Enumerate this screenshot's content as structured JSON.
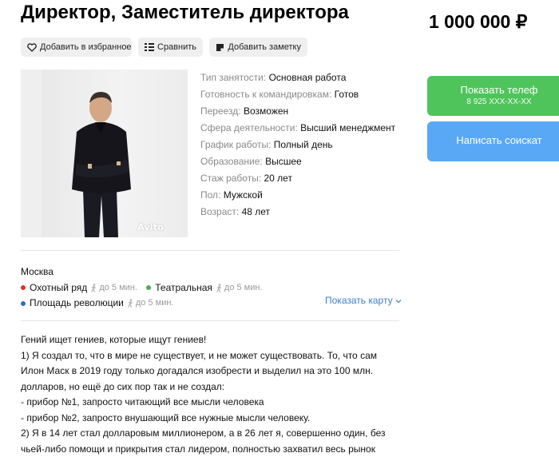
{
  "header": {
    "title": "Директор, Заместитель директора",
    "price": "1 000 000 ₽"
  },
  "actions": {
    "favorite": "Добавить в избранное",
    "compare": "Сравнить",
    "note": "Добавить заметку"
  },
  "photo": {
    "watermark": "Avito"
  },
  "params": [
    {
      "label": "Тип занятости:",
      "value": "Основная работа"
    },
    {
      "label": "Готовность к командировкам:",
      "value": "Готов"
    },
    {
      "label": "Переезд:",
      "value": "Возможен"
    },
    {
      "label": "Сфера деятельности:",
      "value": "Высший менеджмент"
    },
    {
      "label": "График работы:",
      "value": "Полный день"
    },
    {
      "label": "Образование:",
      "value": "Высшее"
    },
    {
      "label": "Стаж работы:",
      "value": "20 лет"
    },
    {
      "label": "Пол:",
      "value": "Мужской"
    },
    {
      "label": "Возраст:",
      "value": "48 лет"
    }
  ],
  "contact": {
    "phone_label": "Показать телеф",
    "phone_number": "8 925 XXX-XX-XX",
    "write_label": "Написать соискат"
  },
  "location": {
    "city": "Москва",
    "metro": [
      {
        "name": "Охотный ряд",
        "walk": "до 5 мин.",
        "color": "#e0322c"
      },
      {
        "name": "Театральная",
        "walk": "до 5 мин.",
        "color": "#4caf50"
      },
      {
        "name": "Площадь революции",
        "walk": "до 5 мин.",
        "color": "#2f6fc4"
      }
    ],
    "map_link": "Показать карту"
  },
  "description": [
    "Гений ищет гениев, которые ищут гениев!",
    "1) Я создал то, что в мире не существует, и не может существовать. То, что сам",
    "Илон Маск в 2019 году только догадался изобрести и выделил на это 100 млн.",
    "долларов, но ещё до сих пор так и не создал:",
    "- прибор №1, запросто читающий все мысли человека",
    "- прибор №2, запросто внушающий все нужные мысли человеку.",
    "2) Я в 14 лет стал долларовым миллионером, а в 26 лет я, совершенно один, без",
    "чьей-либо помощи и прикрытия стал лидером, полностью захватил весь рынок"
  ]
}
